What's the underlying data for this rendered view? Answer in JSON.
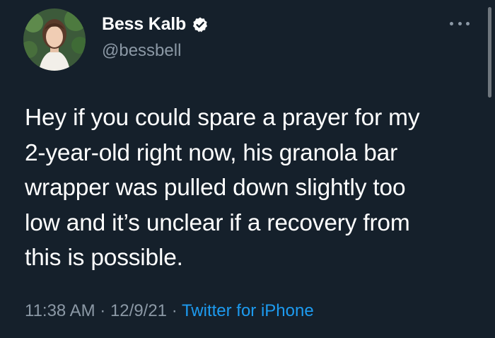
{
  "author": {
    "display_name": "Bess Kalb",
    "handle": "@bessbell",
    "verified": true
  },
  "tweet": {
    "lines": [
      "Hey if you could spare a prayer for my",
      "2-year-old right now, his granola bar",
      "wrapper was pulled down slightly too",
      "low and it’s unclear if a recovery from",
      "this is possible."
    ]
  },
  "meta": {
    "time": "11:38 AM",
    "separator1": " · ",
    "date": "12/9/21",
    "separator2": " · ",
    "source": "Twitter for iPhone"
  },
  "icons": {
    "verified": "verified-badge-icon",
    "more": "more-options-icon"
  },
  "colors": {
    "background": "#15202b",
    "text": "#ffffff",
    "secondary": "#8b98a5",
    "accent": "#1d9bf0"
  }
}
